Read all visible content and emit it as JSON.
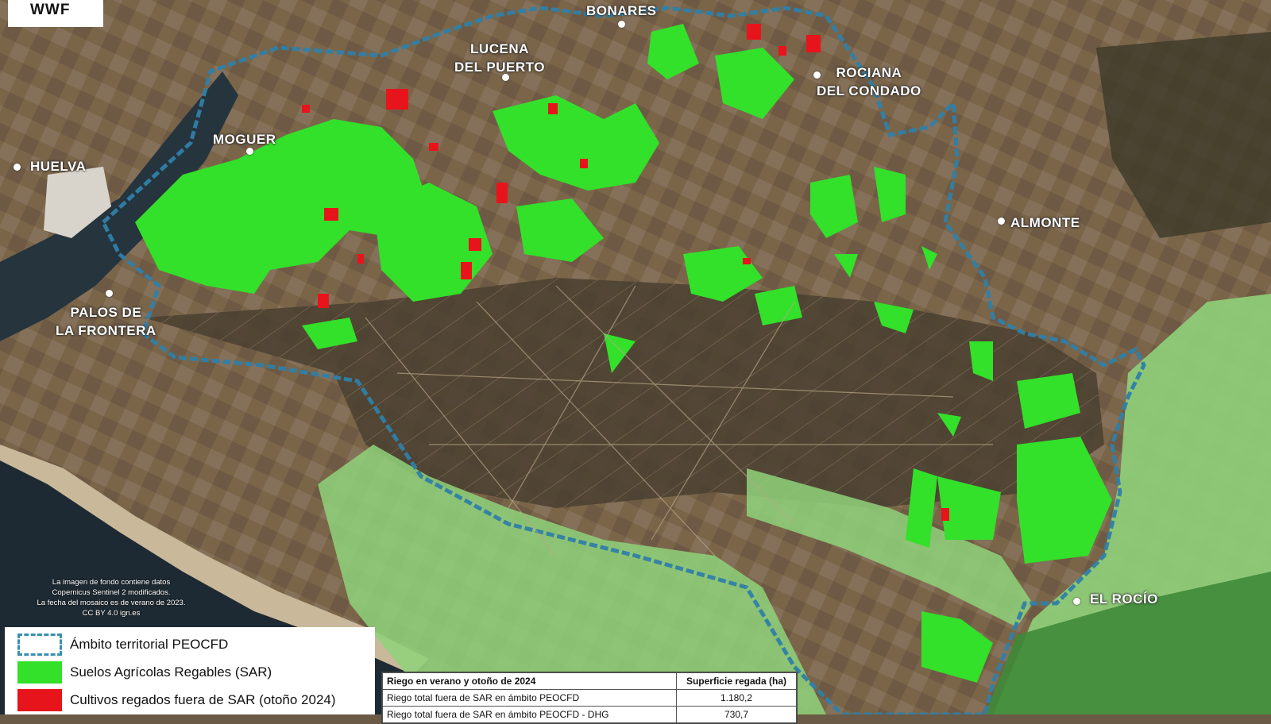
{
  "logo": "WWF",
  "places": [
    {
      "name": "BONARES",
      "line1": "BONARES",
      "line2": ""
    },
    {
      "name": "LUCENA DEL PUERTO",
      "line1": "LUCENA",
      "line2": "DEL PUERTO"
    },
    {
      "name": "ROCIANA DEL CONDADO",
      "line1": "ROCIANA",
      "line2": "DEL CONDADO"
    },
    {
      "name": "MOGUER",
      "line1": "MOGUER",
      "line2": ""
    },
    {
      "name": "HUELVA",
      "line1": "HUELVA",
      "line2": ""
    },
    {
      "name": "ALMONTE",
      "line1": "ALMONTE",
      "line2": ""
    },
    {
      "name": "PALOS DE LA FRONTERA",
      "line1": "PALOS DE",
      "line2": "LA FRONTERA"
    },
    {
      "name": "EL ROCÍO",
      "line1": "EL ROCÍO",
      "line2": ""
    }
  ],
  "credit": {
    "line1": "La imagen de fondo contiene datos",
    "line2": "Copernicus Sentinel 2 modificados.",
    "line3": "La fecha del mosaico es de verano de 2023.",
    "line4": "CC BY 4.0 ign.es"
  },
  "legend": {
    "items": [
      {
        "label": "Ámbito territorial PEOCFD",
        "color": "#3a8fb0"
      },
      {
        "label": "Suelos Agrícolas Regables (SAR)",
        "color": "#33e02a"
      },
      {
        "label": "Cultivos regados fuera de SAR (otoño 2024)",
        "color": "#e8141c"
      }
    ]
  },
  "table": {
    "header_left": "Riego en verano y otoño de 2024",
    "header_right": "Superficie regada (ha)",
    "rows": [
      {
        "label": "Riego total fuera de SAR en ámbito PEOCFD",
        "value": "1.180,2"
      },
      {
        "label": "Riego total fuera de SAR en ámbito PEOCFD - DHG",
        "value": "730,7"
      }
    ]
  },
  "colors": {
    "boundary": "#3a8fb0",
    "sar": "#33e02a",
    "irrigated_outside": "#e8141c",
    "protected_area": "#8fd27a",
    "terrain": "#6b5a45",
    "water": "#1e2a33"
  }
}
